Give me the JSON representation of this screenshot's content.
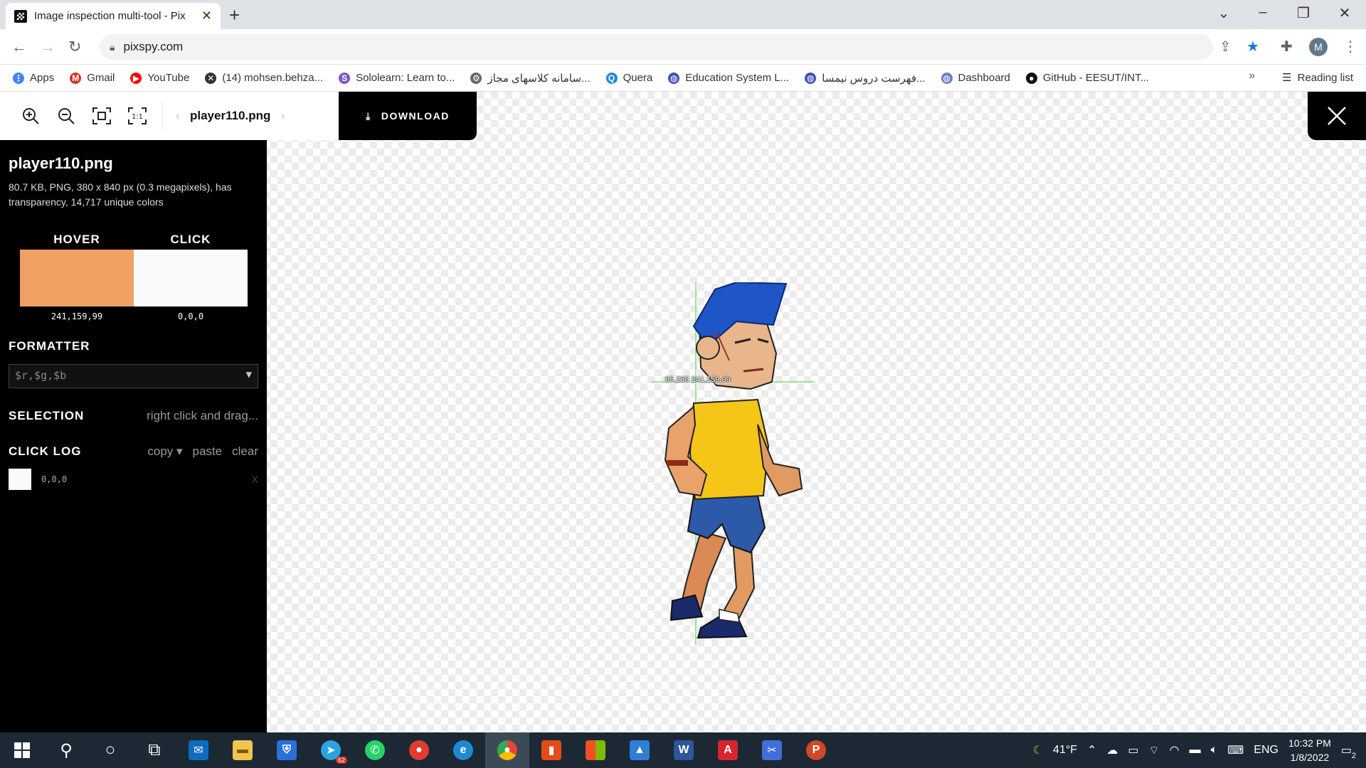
{
  "browser": {
    "tab_title": "Image inspection multi-tool - Pix",
    "url": "pixspy.com",
    "new_tab": "+",
    "avatar_letter": "M"
  },
  "bookmarks": [
    {
      "label": "Apps",
      "icon": "apps-grid-icon",
      "color": "#4285f4"
    },
    {
      "label": "Gmail",
      "icon": "gmail-icon",
      "color": "#d93025"
    },
    {
      "label": "YouTube",
      "icon": "youtube-icon",
      "color": "#ff0000"
    },
    {
      "label": "(14) mohsen.behza...",
      "icon": "x-icon",
      "color": "#333333"
    },
    {
      "label": "Sololearn: Learn to...",
      "icon": "sololearn-icon",
      "color": "#7e57c2"
    },
    {
      "label": "سامانه کلاسهای مجاز...",
      "icon": "university-icon",
      "color": "#666666"
    },
    {
      "label": "Quera",
      "icon": "quera-icon",
      "color": "#1e88e5"
    },
    {
      "label": "Education System L...",
      "icon": "globe-icon",
      "color": "#3f51b5"
    },
    {
      "label": "فهرست دروس نیمسا...",
      "icon": "globe-icon",
      "color": "#3f51b5"
    },
    {
      "label": "Dashboard",
      "icon": "globe-icon",
      "color": "#6a7fc1"
    },
    {
      "label": "GitHub - EESUT/INT...",
      "icon": "github-icon",
      "color": "#111111"
    }
  ],
  "reading_list": "Reading list",
  "tool": {
    "filename": "player110.png",
    "download_label": "DOWNLOAD"
  },
  "sidebar": {
    "title": "player110.png",
    "meta": "80.7 KB, PNG, 380 x 840 px (0.3 megapixels), has transparency, 14,717 unique colors",
    "hover_label": "HOVER",
    "click_label": "CLICK",
    "hover_value": "241,159,99",
    "click_value": "0,0,0",
    "hover_color": "#f1a063",
    "formatter_label": "FORMATTER",
    "formatter_value": "$r,$g,$b",
    "selection_label": "SELECTION",
    "selection_hint": "right click and drag...",
    "click_log_label": "CLICK LOG",
    "copy_label": "copy ▾",
    "paste_label": "paste",
    "clear_label": "clear",
    "log_entries": [
      {
        "value": "0,0,0",
        "remove": "X"
      }
    ]
  },
  "cursor_readout": "95,238 241,159,99",
  "taskbar": {
    "weather": "41°F",
    "language": "ENG",
    "time": "10:32 PM",
    "date": "1/8/2022",
    "telegram_badge": "62",
    "notifications": "2"
  }
}
